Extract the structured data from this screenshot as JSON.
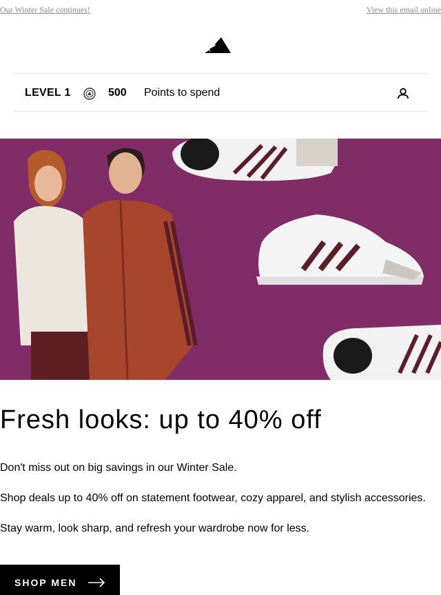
{
  "preheader": {
    "left_link": "Our Winter Sale continues!",
    "right_link": "View this email online"
  },
  "brand": {
    "logo_icon": "adidas-three-stripes-icon"
  },
  "loyalty": {
    "level": "LEVEL 1",
    "coin_icon": "points-coin-icon",
    "points": "500",
    "points_label": "Points to spend",
    "account_icon": "user-icon"
  },
  "hero": {
    "background_color": "#7a2a62",
    "accent_color": "#5a1e28"
  },
  "content": {
    "headline": "Fresh looks: up to 40% off",
    "paragraphs": [
      "Don't miss out on big savings in our Winter Sale.",
      "Shop deals up to 40% off on statement footwear, cozy apparel, and stylish accessories.",
      "Stay warm, look sharp, and refresh your wardrobe now for less."
    ]
  },
  "cta": {
    "label": "SHOP MEN",
    "icon": "arrow-right-icon"
  }
}
